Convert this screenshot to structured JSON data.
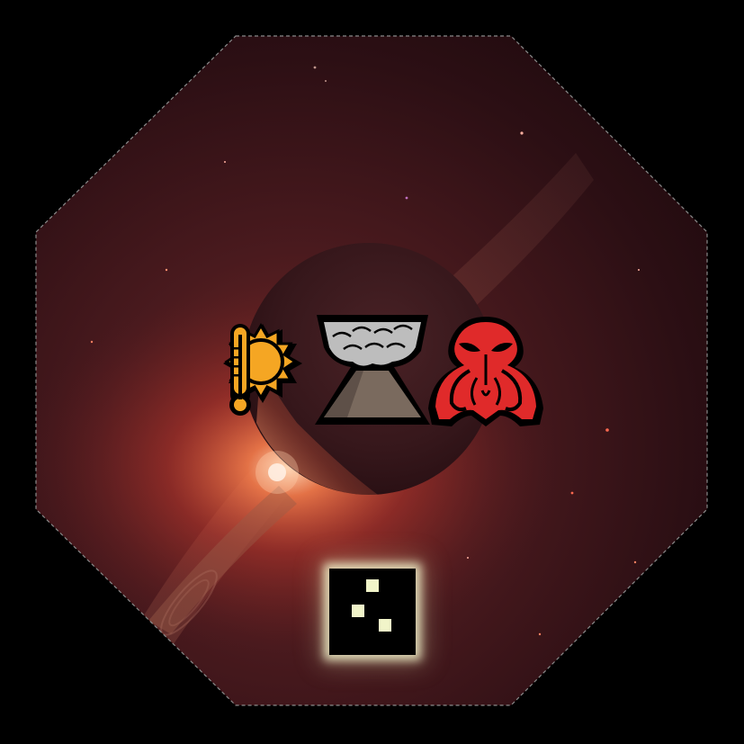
{
  "tile": {
    "shape": "octagon",
    "background": "planet-with-rings",
    "colors": {
      "space": "#2a0e13",
      "nebula_glow": "#e8613e",
      "planet": "#3a1a1e",
      "border": "#8a8a8a",
      "marker_glow": "#f1f4c9"
    }
  },
  "hazards": [
    {
      "icon": "thermometer-sun-icon",
      "meaning": "heat",
      "color": "#f5a623"
    },
    {
      "icon": "volcano-cloud-icon",
      "meaning": "volcanic",
      "color": "#b8b8b8"
    },
    {
      "icon": "alien-creature-icon",
      "meaning": "hostile-life",
      "color": "#e02a2a"
    }
  ],
  "marker": {
    "icon": "tile-marker-icon",
    "pips": 3
  }
}
